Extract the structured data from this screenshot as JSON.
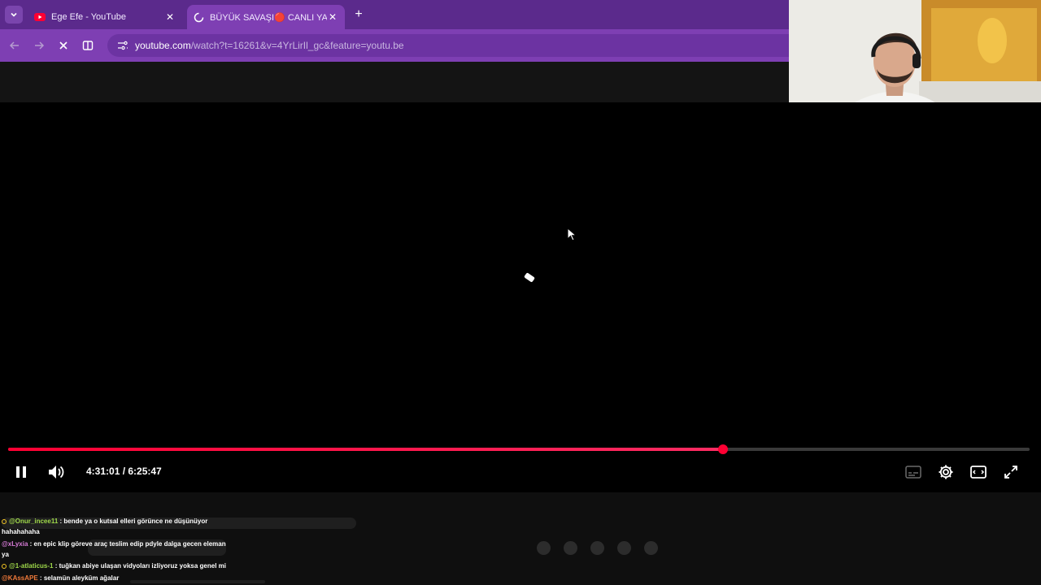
{
  "browser": {
    "tabs": [
      {
        "title": "Ege Efe - YouTube",
        "close": "✕"
      },
      {
        "title": "BÜYÜK SAVAŞI🔴 CANLI YAYIN ...",
        "close": "✕"
      }
    ],
    "new_tab": "+",
    "address": {
      "host": "youtube.com",
      "path": "/watch?t=16261&v=4YrLirIl_gc&feature=youtu.be"
    }
  },
  "player": {
    "time_display": "4:31:01 / 6:25:47",
    "progress_fraction": 0.7
  },
  "chat": {
    "messages": [
      {
        "user": "@Onur_incee11",
        "text": " : bende ya o kutsal elleri görünce ne düşünüyor",
        "wrap": "hahahahaha",
        "user_color": "#9fd94a",
        "badge": true
      },
      {
        "user": "@xLyxia",
        "text": " : en epic klip göreve araç teslim edip pdyle dalga gecen eleman",
        "wrap": "ya",
        "user_color": "#d67bd6",
        "badge": false
      },
      {
        "user": "@1-atlaticus-1",
        "text": " : tuğkan abiye ulaşan vidyoları izliyoruz yoksa genel mi",
        "wrap": "",
        "user_color": "#9fd94a",
        "badge": true
      },
      {
        "user": "@KAssAPE",
        "text": " : selamün aleyküm ağalar",
        "wrap": "",
        "user_color": "#f07a3a",
        "badge": false
      }
    ]
  },
  "colors": {
    "tabbar": "#5b2a8c",
    "toolbar": "#7e3fb3",
    "progress": "#ff0033"
  }
}
